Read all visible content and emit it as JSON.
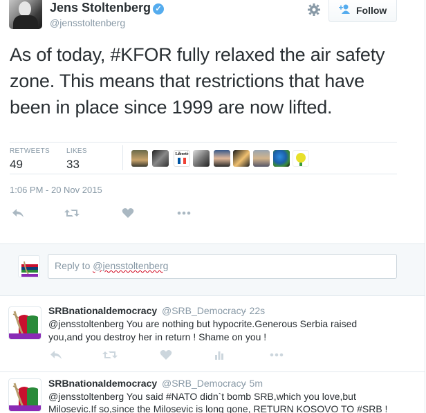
{
  "tweet": {
    "author_name": "Jens Stoltenberg",
    "author_handle": "@jensstoltenberg",
    "verified_badge": "✓",
    "follow_label": "Follow",
    "text": "As of today, #KFOR fully relaxed the air safety zone. This means that restrictions that have been in place since 1999 are now lifted.",
    "retweets_label": "RETWEETS",
    "retweets_count": "49",
    "likes_label": "LIKES",
    "likes_count": "33",
    "timestamp": "1:06 PM - 20 Nov 2015",
    "liker_avatar_text": "Liberté"
  },
  "reply_box": {
    "prefix": "Reply to ",
    "handle": "@jensstoltenberg"
  },
  "replies": [
    {
      "name": "SRBnationaldemocracy",
      "handle": "@SRB_Democracy",
      "time": "· 22s",
      "text_line1": "@jensstoltenberg You are nothing but hypocrite.Generous Serbia raised",
      "text_line2": "you,and you destroy her in return ! Shame on you !"
    },
    {
      "name": "SRBnationaldemocracy",
      "handle": "@SRB_Democracy",
      "time": "· 5m",
      "text_line1": "@jensstoltenberg You said #NATO didn`t bomb SRB,which you love,but",
      "text_line2": "Milosevic.If so,since the Milosevic is long gone, RETURN KOSOVO TO #SRB !"
    }
  ],
  "icons": {
    "reply": "reply-icon",
    "retweet": "retweet-icon",
    "like": "heart-icon",
    "more": "more-icon",
    "stats": "analytics-icon"
  },
  "colors": {
    "accent": "#55acee",
    "muted": "#8899a6",
    "text": "#292f33"
  }
}
